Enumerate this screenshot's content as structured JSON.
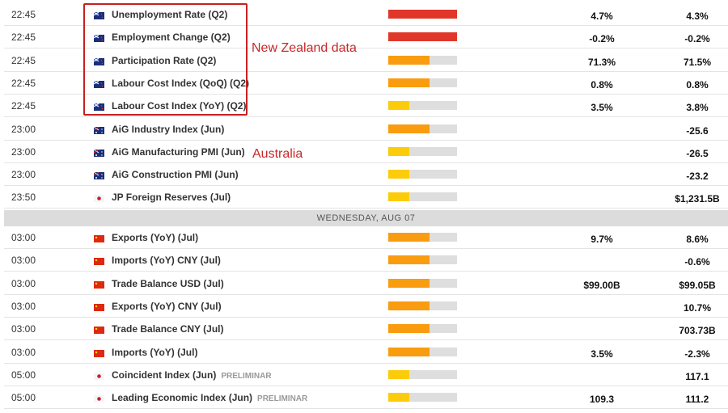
{
  "colors": {
    "high": "#e0372a",
    "medium": "#f99c10",
    "low": "#fccc0a",
    "track": "#dedede",
    "annotation": "#c82020"
  },
  "annotations": {
    "nz": "New Zealand data",
    "au": "Australia"
  },
  "day_header": "WEDNESDAY, AUG 07",
  "group1": [
    {
      "time": "22:45",
      "flag": "nz",
      "event": "Unemployment Rate (Q2)",
      "impact": "high",
      "impact_level": 1.0,
      "actual": "4.7%",
      "previous": "4.3%"
    },
    {
      "time": "22:45",
      "flag": "nz",
      "event": "Employment Change (Q2)",
      "impact": "high",
      "impact_level": 1.0,
      "actual": "-0.2%",
      "previous": "-0.2%"
    },
    {
      "time": "22:45",
      "flag": "nz",
      "event": "Participation Rate (Q2)",
      "impact": "medium",
      "impact_level": 0.6,
      "actual": "71.3%",
      "previous": "71.5%"
    },
    {
      "time": "22:45",
      "flag": "nz",
      "event": "Labour Cost Index (QoQ) (Q2)",
      "impact": "medium",
      "impact_level": 0.6,
      "actual": "0.8%",
      "previous": "0.8%"
    },
    {
      "time": "22:45",
      "flag": "nz",
      "event": "Labour Cost Index (YoY) (Q2)",
      "impact": "low",
      "impact_level": 0.3,
      "actual": "3.5%",
      "previous": "3.8%"
    },
    {
      "time": "23:00",
      "flag": "au",
      "event": "AiG Industry Index (Jun)",
      "impact": "medium",
      "impact_level": 0.6,
      "actual": "",
      "previous": "-25.6"
    },
    {
      "time": "23:00",
      "flag": "au",
      "event": "AiG Manufacturing PMI (Jun)",
      "impact": "low",
      "impact_level": 0.3,
      "actual": "",
      "previous": "-26.5"
    },
    {
      "time": "23:00",
      "flag": "au",
      "event": "AiG Construction PMI (Jun)",
      "impact": "low",
      "impact_level": 0.3,
      "actual": "",
      "previous": "-23.2"
    },
    {
      "time": "23:50",
      "flag": "jp",
      "event": "JP Foreign Reserves (Jul)",
      "impact": "low",
      "impact_level": 0.3,
      "actual": "",
      "previous": "$1,231.5B"
    }
  ],
  "group2": [
    {
      "time": "03:00",
      "flag": "cn",
      "event": "Exports (YoY) (Jul)",
      "impact": "medium",
      "impact_level": 0.6,
      "actual": "9.7%",
      "previous": "8.6%"
    },
    {
      "time": "03:00",
      "flag": "cn",
      "event": "Imports (YoY) CNY (Jul)",
      "impact": "medium",
      "impact_level": 0.6,
      "actual": "",
      "previous": "-0.6%"
    },
    {
      "time": "03:00",
      "flag": "cn",
      "event": "Trade Balance USD (Jul)",
      "impact": "medium",
      "impact_level": 0.6,
      "actual": "$99.00B",
      "previous": "$99.05B"
    },
    {
      "time": "03:00",
      "flag": "cn",
      "event": "Exports (YoY) CNY (Jul)",
      "impact": "medium",
      "impact_level": 0.6,
      "actual": "",
      "previous": "10.7%"
    },
    {
      "time": "03:00",
      "flag": "cn",
      "event": "Trade Balance CNY (Jul)",
      "impact": "medium",
      "impact_level": 0.6,
      "actual": "",
      "previous": "703.73B"
    },
    {
      "time": "03:00",
      "flag": "cn",
      "event": "Imports (YoY) (Jul)",
      "impact": "medium",
      "impact_level": 0.6,
      "actual": "3.5%",
      "previous": "-2.3%"
    },
    {
      "time": "05:00",
      "flag": "jp",
      "event": "Coincident Index (Jun)",
      "tag": "PRELIMINAR",
      "impact": "low",
      "impact_level": 0.3,
      "actual": "",
      "previous": "117.1"
    },
    {
      "time": "05:00",
      "flag": "jp",
      "event": "Leading Economic Index (Jun)",
      "tag": "PRELIMINAR",
      "impact": "low",
      "impact_level": 0.3,
      "actual": "109.3",
      "previous": "111.2"
    }
  ]
}
